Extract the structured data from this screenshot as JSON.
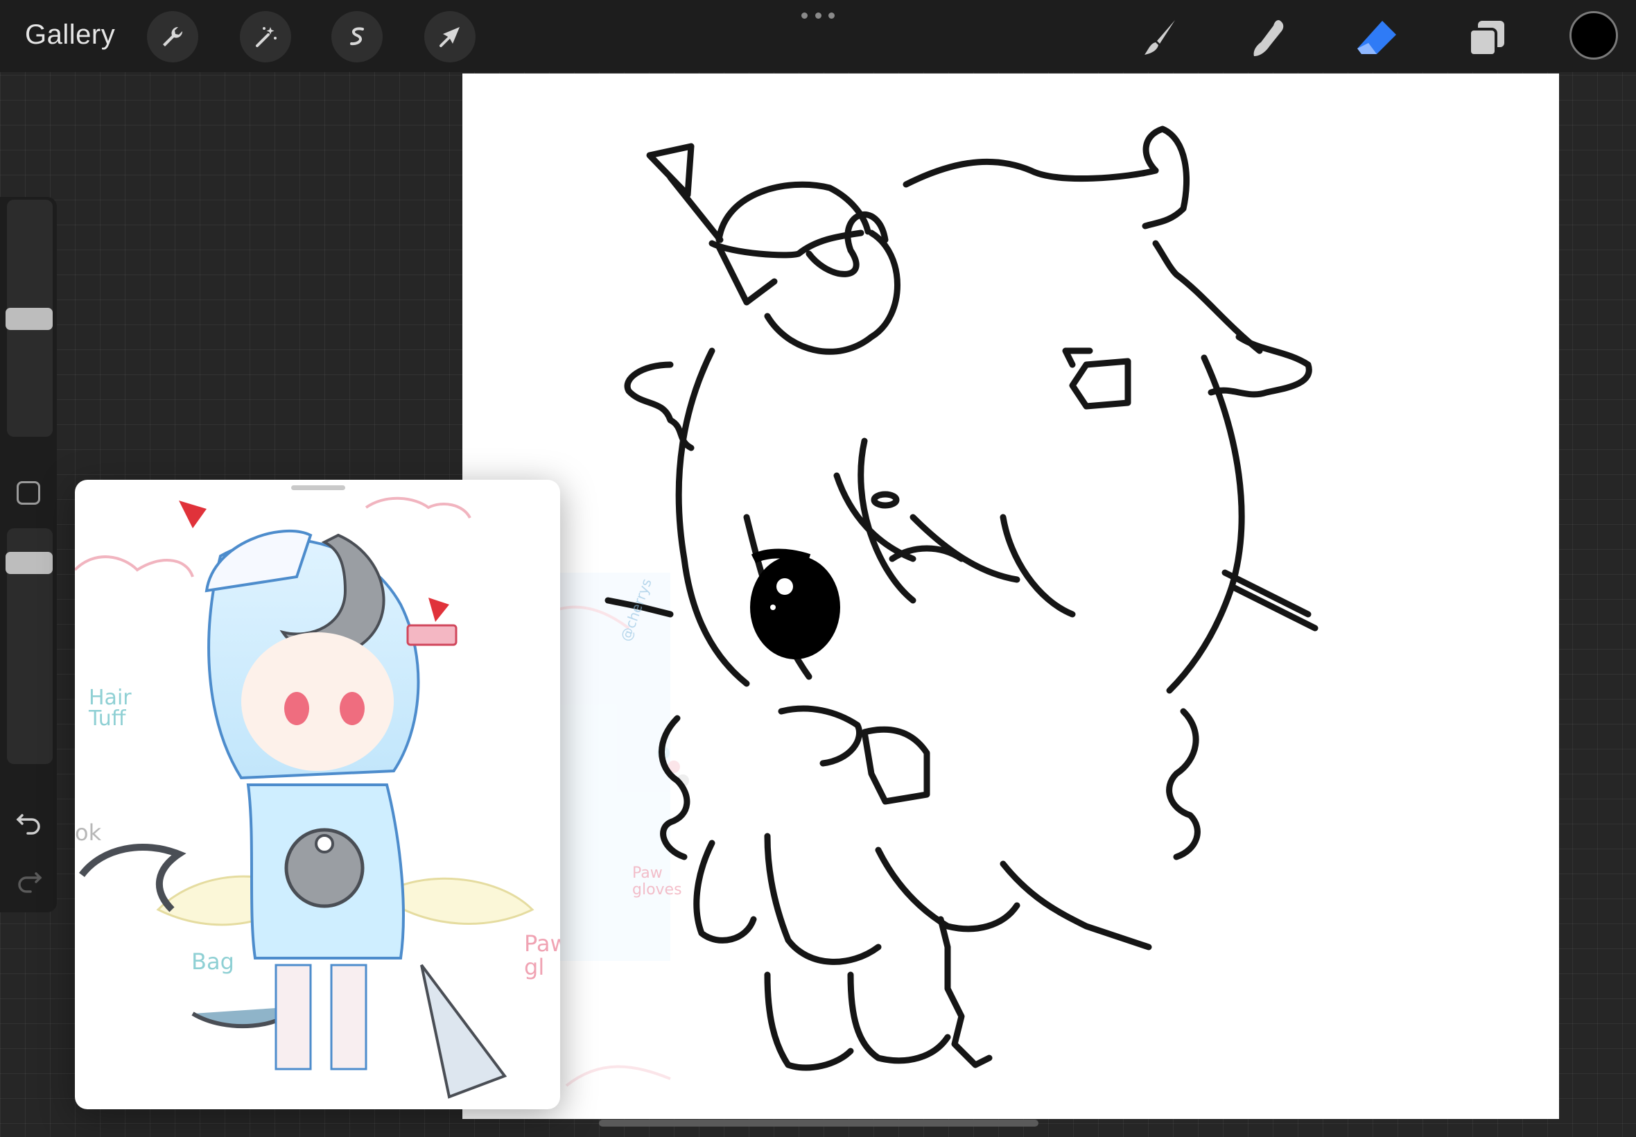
{
  "topbar": {
    "gallery_label": "Gallery",
    "left_tools": [
      "wrench-icon",
      "magic-wand-icon",
      "selection-icon",
      "transform-arrow-icon"
    ],
    "right_tools": [
      "brush-icon",
      "smudge-icon",
      "eraser-icon",
      "layers-icon"
    ],
    "active_tool": "eraser-icon",
    "accent_color": "#2f7bf6",
    "current_color": "#000000"
  },
  "sidebar": {
    "icons": [
      "modify-square-icon",
      "undo-icon",
      "redo-icon"
    ]
  },
  "reference": {
    "annotations": {
      "hair_tuft": "Hair\nTuff",
      "bag": "Bag",
      "paw_gloves_partial": "Paw\ngl",
      "paw_gloves": "Paw\ngloves",
      "watermark": "@cherrys",
      "cropped_left": "ok"
    }
  }
}
